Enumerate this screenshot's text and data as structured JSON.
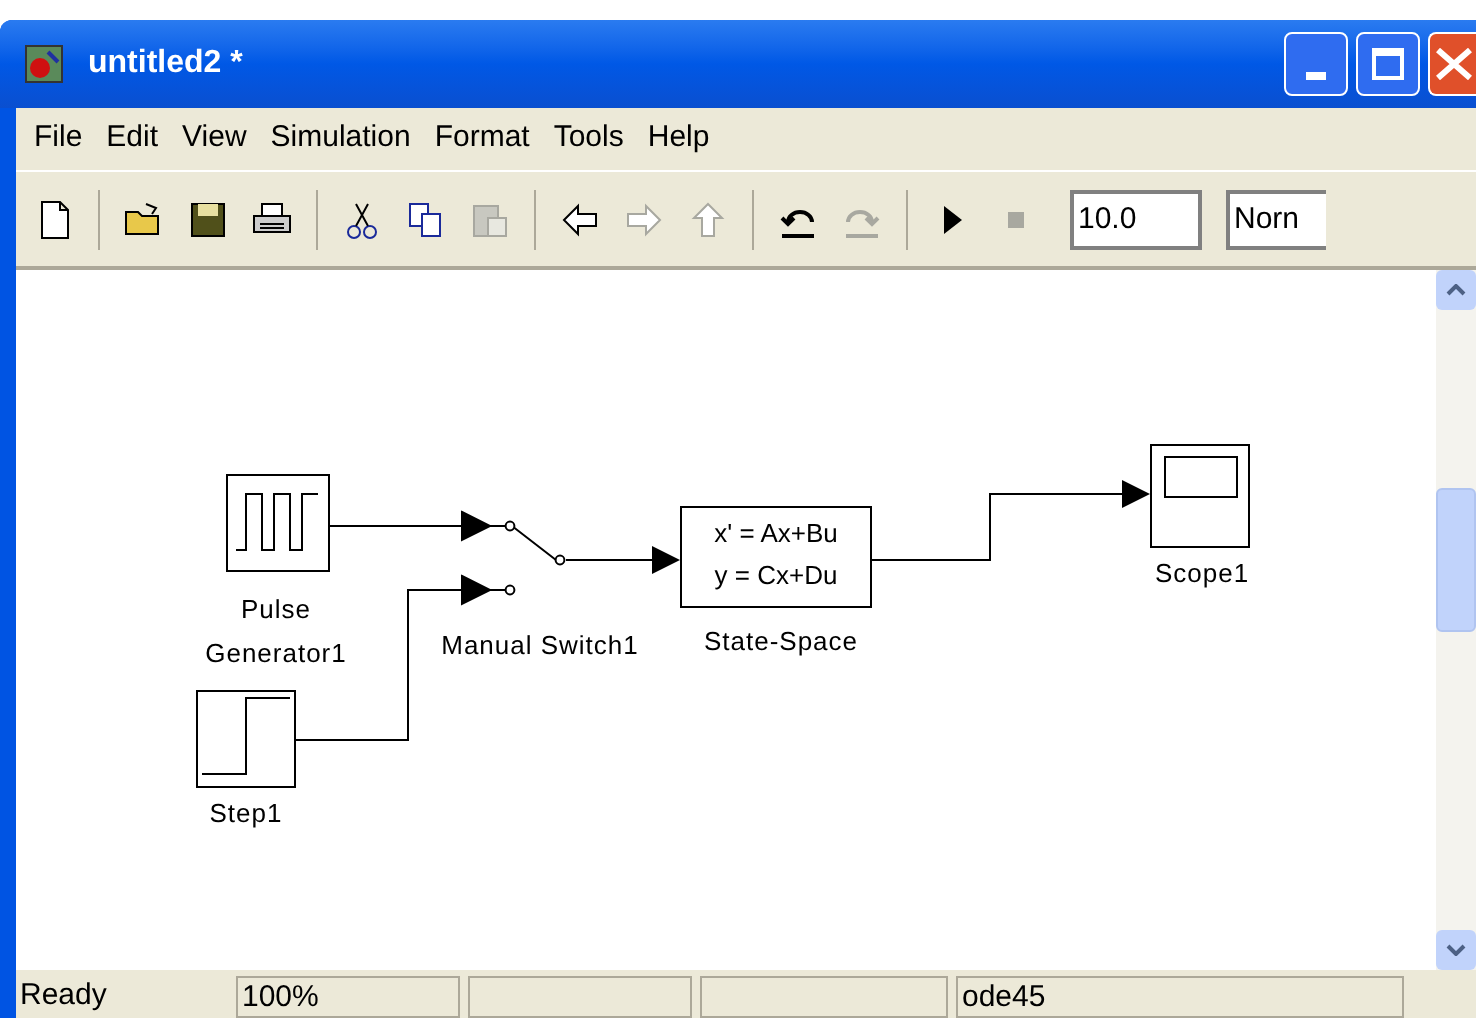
{
  "window": {
    "title": "untitled2 *"
  },
  "menu": [
    "File",
    "Edit",
    "View",
    "Simulation",
    "Format",
    "Tools",
    "Help"
  ],
  "toolbar": [
    {
      "kind": "new",
      "disabled": false
    },
    {
      "kind": "sep"
    },
    {
      "kind": "open",
      "disabled": false
    },
    {
      "kind": "save",
      "disabled": false
    },
    {
      "kind": "print",
      "disabled": false
    },
    {
      "kind": "sep"
    },
    {
      "kind": "cut",
      "disabled": false
    },
    {
      "kind": "copy",
      "disabled": false
    },
    {
      "kind": "paste",
      "disabled": true
    },
    {
      "kind": "sep"
    },
    {
      "kind": "back",
      "disabled": false
    },
    {
      "kind": "forward",
      "disabled": true
    },
    {
      "kind": "up",
      "disabled": true
    },
    {
      "kind": "sep"
    },
    {
      "kind": "undo",
      "disabled": false
    },
    {
      "kind": "redo",
      "disabled": true
    },
    {
      "kind": "sep"
    },
    {
      "kind": "play",
      "disabled": false
    },
    {
      "kind": "stop",
      "disabled": true
    }
  ],
  "stop_time": {
    "value": "10.0"
  },
  "sim_mode": {
    "value": "Norn"
  },
  "blocks": [
    {
      "kind": "pulse",
      "label": [
        "Pulse",
        "Generator1"
      ]
    },
    {
      "kind": "step",
      "label": [
        "Step1"
      ]
    },
    {
      "kind": "switch",
      "label": [
        "Manual Switch1"
      ]
    },
    {
      "kind": "statespace",
      "label": [
        "State-Space"
      ],
      "lines": [
        "x' = Ax+Bu",
        "y = Cx+Du"
      ]
    },
    {
      "kind": "scope",
      "label": [
        "Scope1"
      ]
    }
  ],
  "status_bar": [
    {
      "kind": "plain",
      "text": "Ready"
    },
    {
      "kind": "field",
      "text": "100%"
    },
    {
      "kind": "field"
    },
    {
      "kind": "field"
    },
    {
      "kind": "field",
      "text": "ode45"
    }
  ]
}
